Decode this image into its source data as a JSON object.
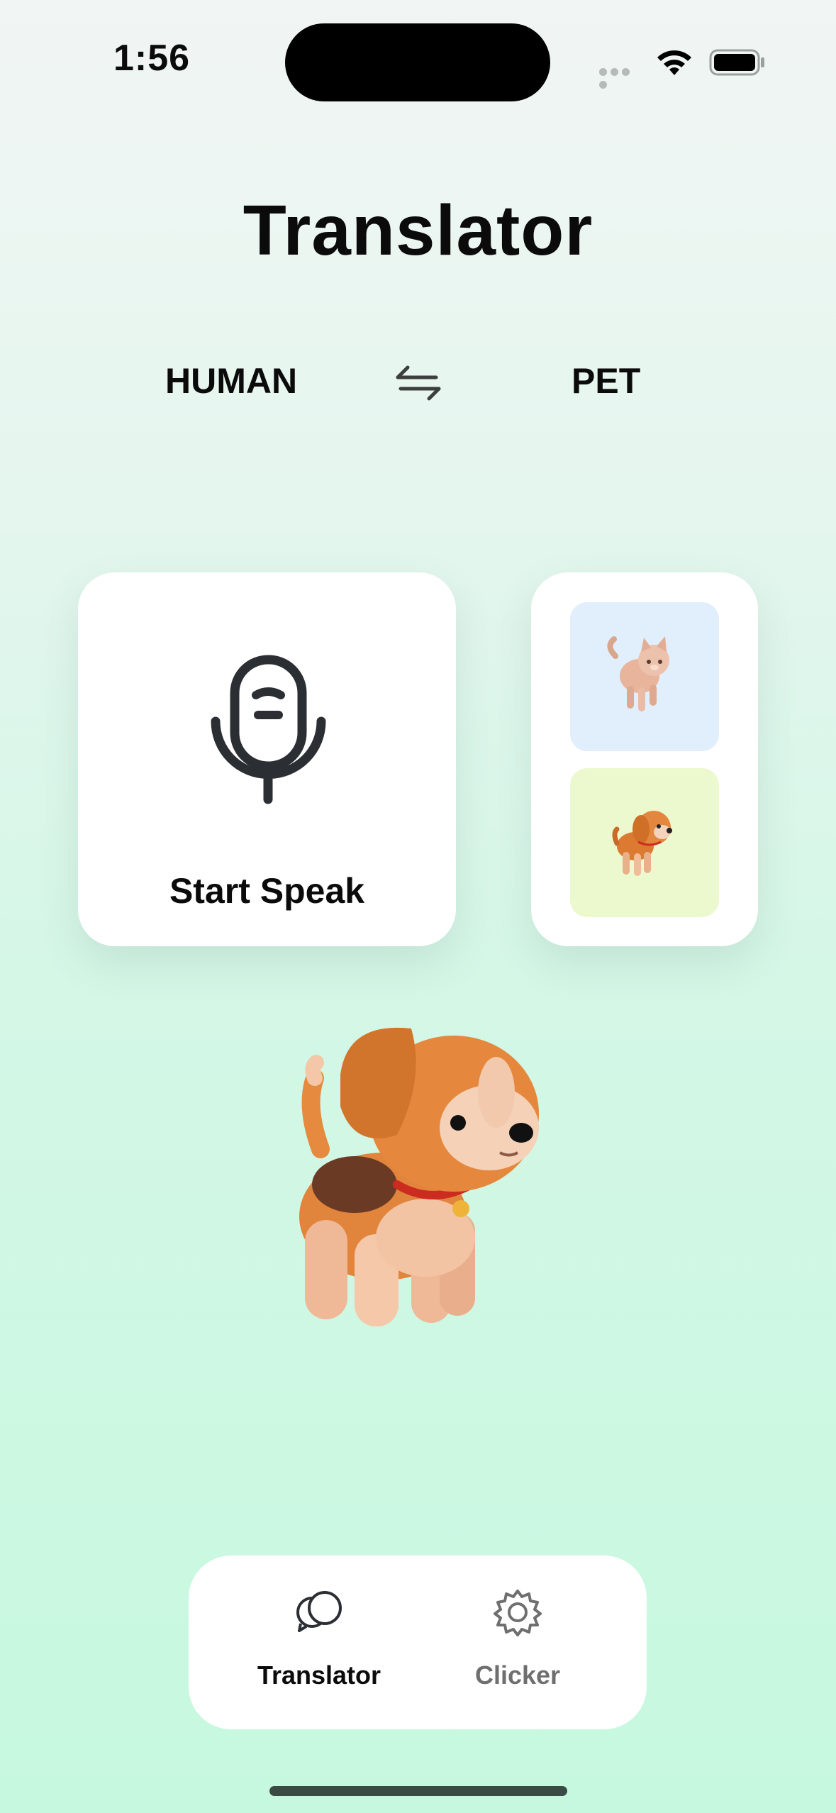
{
  "status": {
    "time": "1:56"
  },
  "title": "Translator",
  "languages": {
    "from": "HUMAN",
    "to": "PET"
  },
  "speak_card": {
    "label": "Start Speak"
  },
  "pets": [
    {
      "name": "cat",
      "bg": "#e1eefc"
    },
    {
      "name": "dog",
      "bg": "#ecf9ce"
    }
  ],
  "tabbar": {
    "items": [
      {
        "label": "Translator",
        "icon": "chat-bubbles-icon",
        "active": true,
        "color": "#0b0b0b"
      },
      {
        "label": "Clicker",
        "icon": "gear-icon",
        "active": false,
        "color": "#6f6f6f"
      }
    ]
  }
}
